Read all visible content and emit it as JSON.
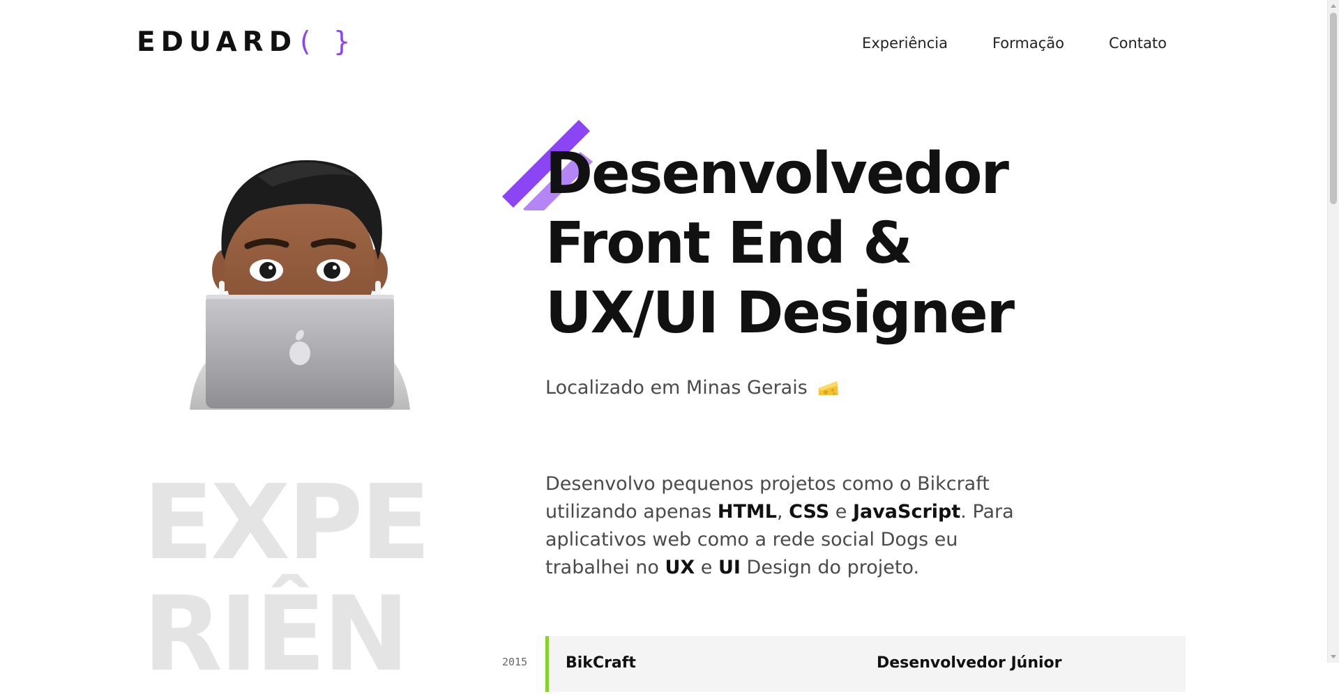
{
  "header": {
    "logo_text": "EDUARD",
    "logo_braces": "( }",
    "nav": [
      "Experiência",
      "Formação",
      "Contato"
    ]
  },
  "hero": {
    "title_lines": [
      "Desenvolvedor",
      "Front End &",
      "UX/UI Designer"
    ],
    "location": "Localizado em Minas Gerais",
    "location_icon": "cheese-icon",
    "bio": {
      "p1": "Desenvolvo pequenos projetos como o Bikcraft utilizando apenas ",
      "html": "HTML",
      "sep1": ", ",
      "css": "CSS",
      "sep2": " e ",
      "js": "JavaScript",
      "p2": ". Para aplicativos web como a rede social Dogs eu trabalhei no ",
      "ux": "UX",
      "sep3": " e ",
      "ui": "UI",
      "p3": " Design do projeto."
    },
    "avatar_icon": "memoji-avatar-with-laptop"
  },
  "experience": {
    "background_title_lines": [
      "EXPE",
      "RIÊN"
    ],
    "items": [
      {
        "year": "2015",
        "company": "BikCraft",
        "role": "Desenvolvedor Júnior"
      }
    ]
  },
  "colors": {
    "accent": "#8c45f2",
    "accent_light": "#b486f5",
    "text": "#111111",
    "muted_text": "#4a4a4a",
    "watermark": "#e4e4e4",
    "card_bg": "#f4f4f4",
    "card_border": "#84d22a"
  }
}
